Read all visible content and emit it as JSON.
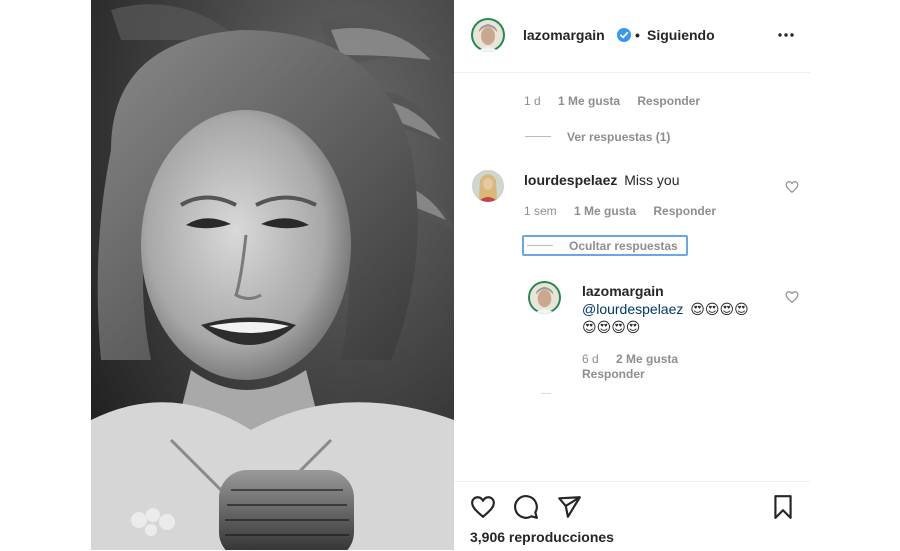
{
  "post": {
    "author": "lazomargain",
    "follow_status": "Siguiendo",
    "separator": "•"
  },
  "comments": [
    {
      "time": "1 d",
      "likes": "1 Me gusta",
      "reply": "Responder",
      "view_replies": "Ver respuestas (1)"
    },
    {
      "user": "lourdespelaez",
      "text": "Miss you",
      "time": "1 sem",
      "likes": "1 Me gusta",
      "reply": "Responder",
      "hide_replies": "Ocultar respuestas",
      "replies": [
        {
          "user": "lazomargain",
          "mention": "@lourdespelaez",
          "emoji_line1": "😍😍😍😍",
          "emoji_line2": "😍😍😍😍",
          "time": "6 d",
          "likes": "2 Me gusta",
          "reply": "Responder"
        }
      ]
    }
  ],
  "footer": {
    "views": "3,906 reproducciones"
  },
  "colors": {
    "verified": "#3897f0",
    "mention": "#00376b",
    "secondary_text": "#8e8e8e",
    "focus_outline": "#6aa6e8"
  },
  "icons": [
    "verified-badge-icon",
    "more-options-icon",
    "heart-icon",
    "comment-icon",
    "share-icon",
    "bookmark-icon"
  ]
}
